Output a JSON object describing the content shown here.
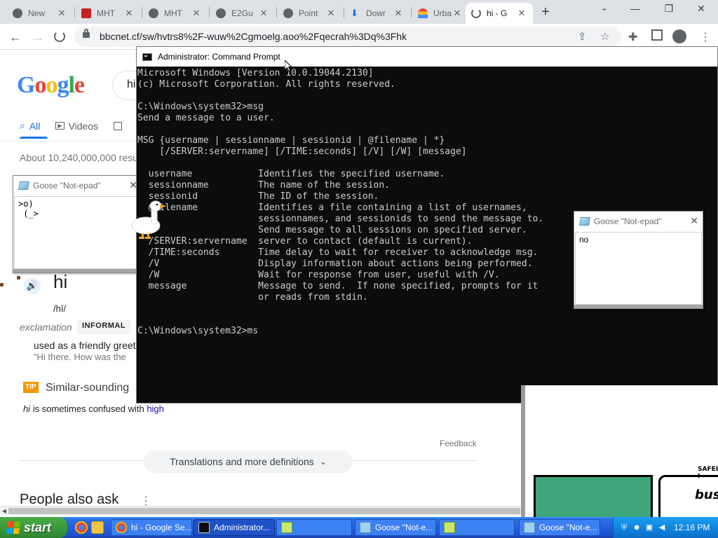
{
  "browser": {
    "tabs": [
      {
        "title": "New",
        "favicon_color": "#5f6368"
      },
      {
        "title": "MHT",
        "favicon_color": "#c5221f"
      },
      {
        "title": "MHT",
        "favicon_color": "#5f6368"
      },
      {
        "title": "E2Gu",
        "favicon_color": "#5f6368"
      },
      {
        "title": "Point",
        "favicon_color": "#5f6368"
      },
      {
        "title": "Dowr",
        "favicon_color": "#1a73e8"
      },
      {
        "title": "Urba",
        "favicon_color": "#f29900"
      },
      {
        "title": "hi - G",
        "favicon_color": "#ffffff"
      }
    ],
    "new_tab_symbol": "+",
    "window_controls": {
      "minimize": "—",
      "restore": "❐",
      "close": "✕"
    },
    "url": "bbcnet.cf/sw/hvtrs8%2F-wuw%2Cgmoelg.aoo%2Fqecrah%3Dq%3Fhk",
    "nav": {
      "back": "←",
      "forward": "→"
    }
  },
  "google": {
    "logo": "Google",
    "search_value": "hi",
    "tabs": [
      {
        "label": "All",
        "icon": "🔍"
      },
      {
        "label": "Videos",
        "icon": "▶"
      }
    ],
    "stats": "About 10,240,000,000 resu",
    "word": "hi",
    "phonetic": "/hī/",
    "part_of_speech": "exclamation",
    "register": "INFORMAL",
    "definition": "used as a friendly greet",
    "example": "\"Hi there. How was the",
    "tip_badge": "TIP",
    "similar_heading": "Similar-sounding",
    "confused_word": "hi",
    "confused_text": " is sometimes confused with ",
    "confused_link": "high",
    "feedback": "Feedback",
    "more_defs_button": "Translations and more definitions",
    "people_also_ask": "People also ask"
  },
  "cmd": {
    "title": "Administrator: Command Prompt",
    "lines": [
      "Microsoft Windows [Version 10.0.19044.2130]",
      "(c) Microsoft Corporation. All rights reserved.",
      "",
      "C:\\Windows\\system32>msg",
      "Send a message to a user.",
      "",
      "MSG {username | sessionname | sessionid | @filename | *}",
      "    [/SERVER:servername] [/TIME:seconds] [/V] [/W] [message]",
      "",
      "  username            Identifies the specified username.",
      "  sessionname         The name of the session.",
      "  sessionid           The ID of the session.",
      "  @filename           Identifies a file containing a list of usernames,",
      "                      sessionnames, and sessionids to send the message to.",
      "                      Send message to all sessions on specified server.",
      "  /SERVER:servername  server to contact (default is current).",
      "  /TIME:seconds       Time delay to wait for receiver to acknowledge msg.",
      "  /V                  Display information about actions being performed.",
      "  /W                  Wait for response from user, useful with /V.",
      "  message             Message to send.  If none specified, prompts for it",
      "                      or reads from stdin.",
      "",
      "",
      "C:\\Windows\\system32>ms"
    ]
  },
  "goose_left": {
    "title": "Goose \"Not-epad\"",
    "body": ">o)\n (_>"
  },
  "goose_right": {
    "title": "Goose \"Not-epad\"",
    "body": "no"
  },
  "comic": {
    "safely_text": "SAFELY I",
    "busy_text": "busy"
  },
  "taskbar": {
    "start_label": "start",
    "buttons": [
      {
        "label": "hi - Google Se...",
        "icon_color": "#ffffff"
      },
      {
        "label": "Administrator...",
        "icon_color": "#0c0c0c"
      },
      {
        "label": "",
        "icon_color": "#c8e86a"
      },
      {
        "label": "Goose \"Not-e...",
        "icon_color": "#9fd0ee"
      },
      {
        "label": "",
        "icon_color": "#c8e86a"
      },
      {
        "label": "Goose \"Not-e...",
        "icon_color": "#9fd0ee"
      }
    ],
    "clock": "12:16 PM"
  }
}
